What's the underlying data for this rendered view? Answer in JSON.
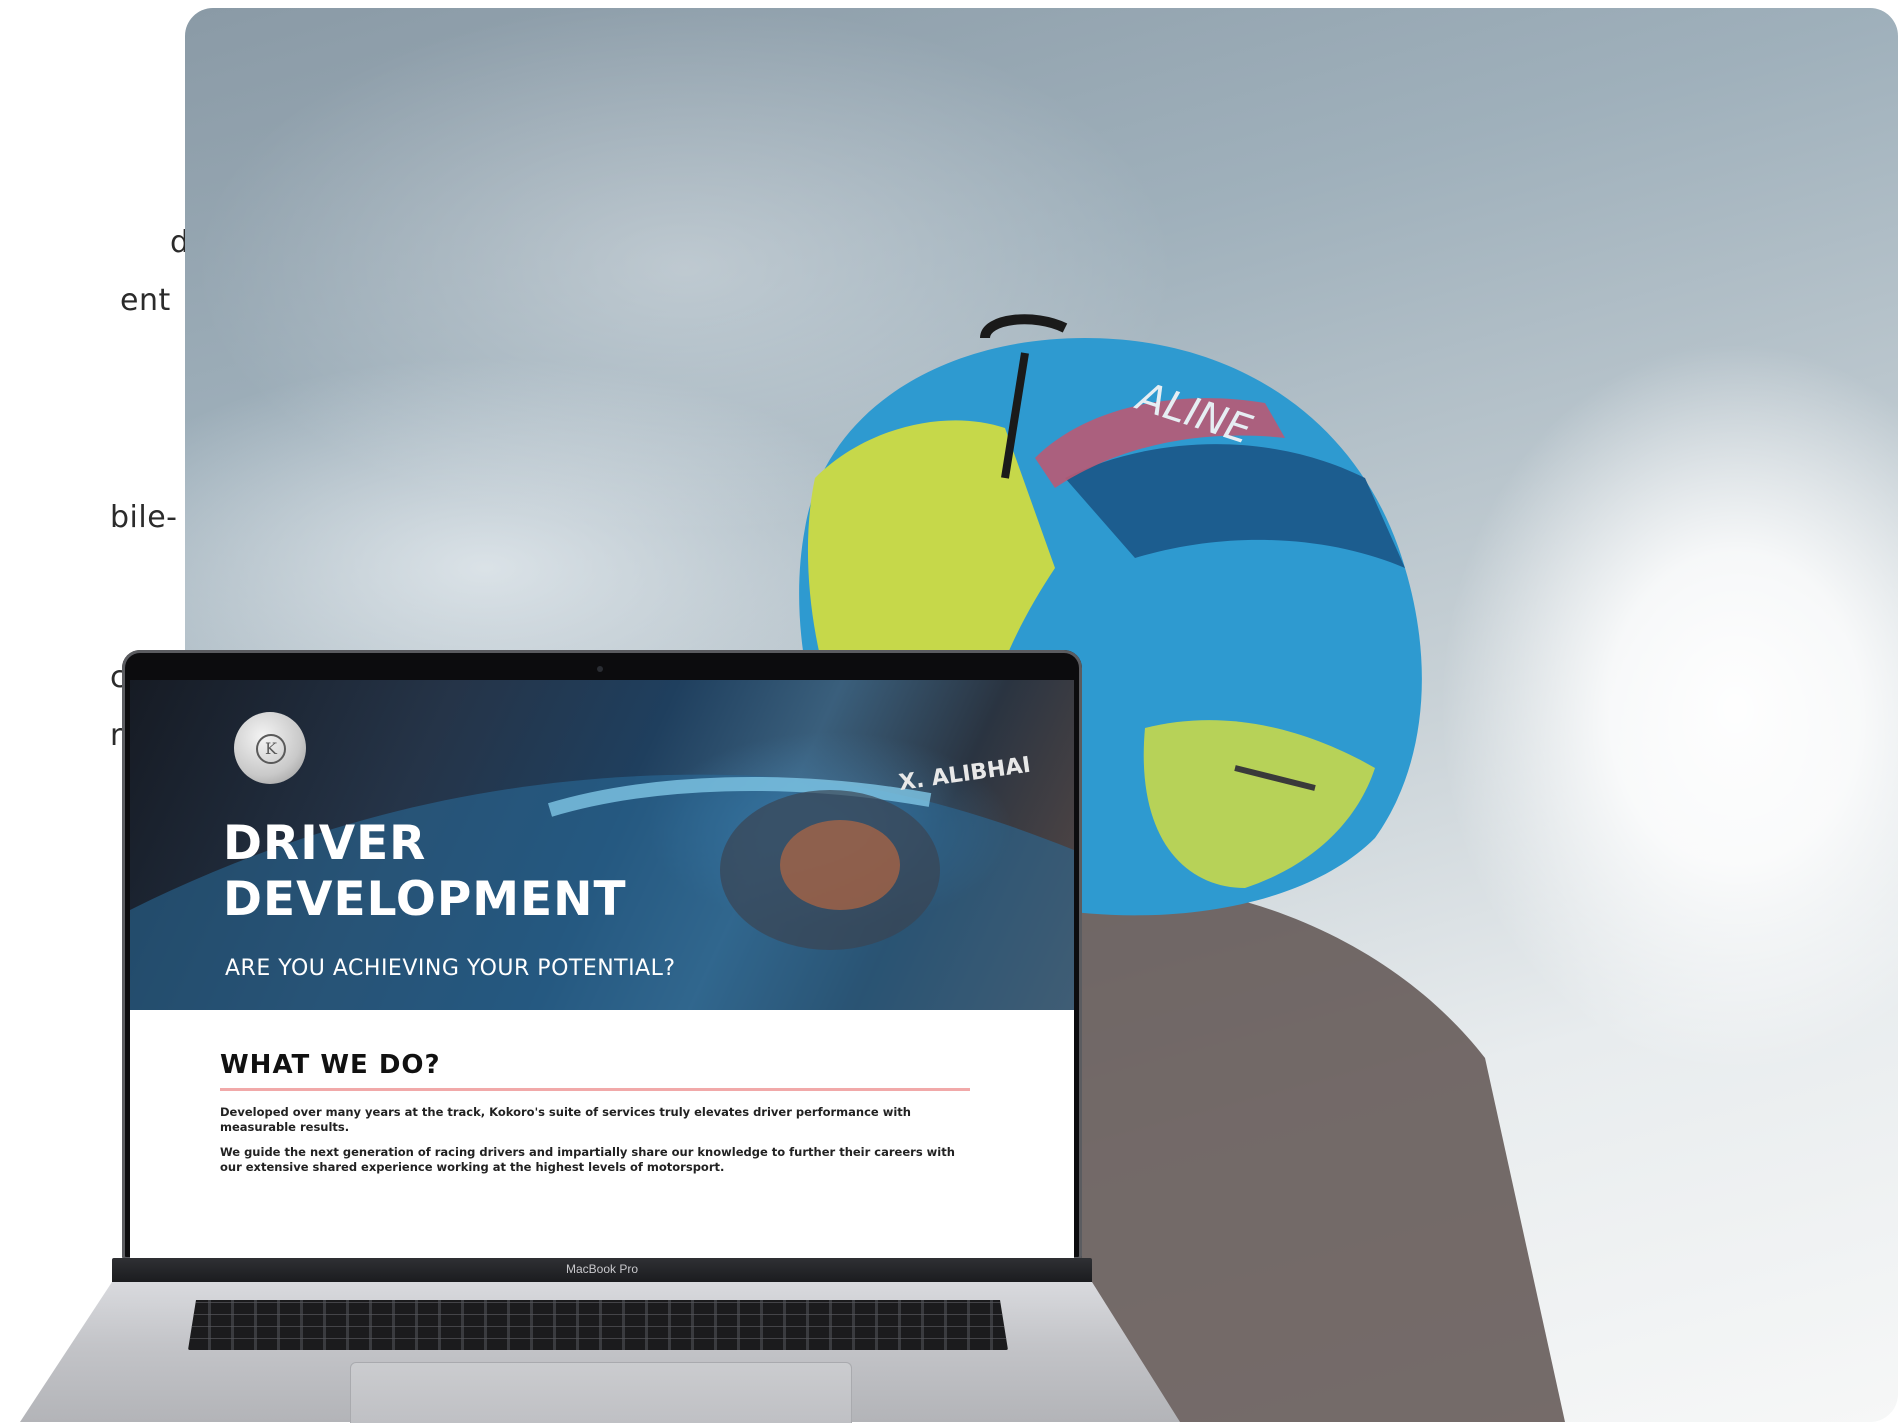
{
  "left_text": {
    "lines": [
      "d",
      "ent",
      "bile-",
      "ces",
      "n the"
    ]
  },
  "hero_photo": {
    "subject": "helmet",
    "helmet_text": "ALINE"
  },
  "laptop": {
    "brand_label": "MacBook Pro",
    "screen": {
      "logo_letter": "K",
      "title_line1": "DRIVER",
      "title_line2": "DEVELOPMENT",
      "subtitle": "ARE YOU ACHIEVING YOUR POTENTIAL?",
      "car_label": "X. ALIBHAI",
      "section_heading": "WHAT WE DO?",
      "paragraph1": "Developed over many years at the track, Kokoro's suite of services truly elevates driver performance with measurable results.",
      "paragraph2": "We guide the next generation of racing drivers and impartially share our knowledge to further their careers with our extensive shared experience working at the highest levels of motorsport."
    }
  },
  "colors": {
    "accent_underline": "#f1a9a9",
    "helmet_yellow": "#c6d84a",
    "helmet_blue": "#2d8fc8"
  }
}
